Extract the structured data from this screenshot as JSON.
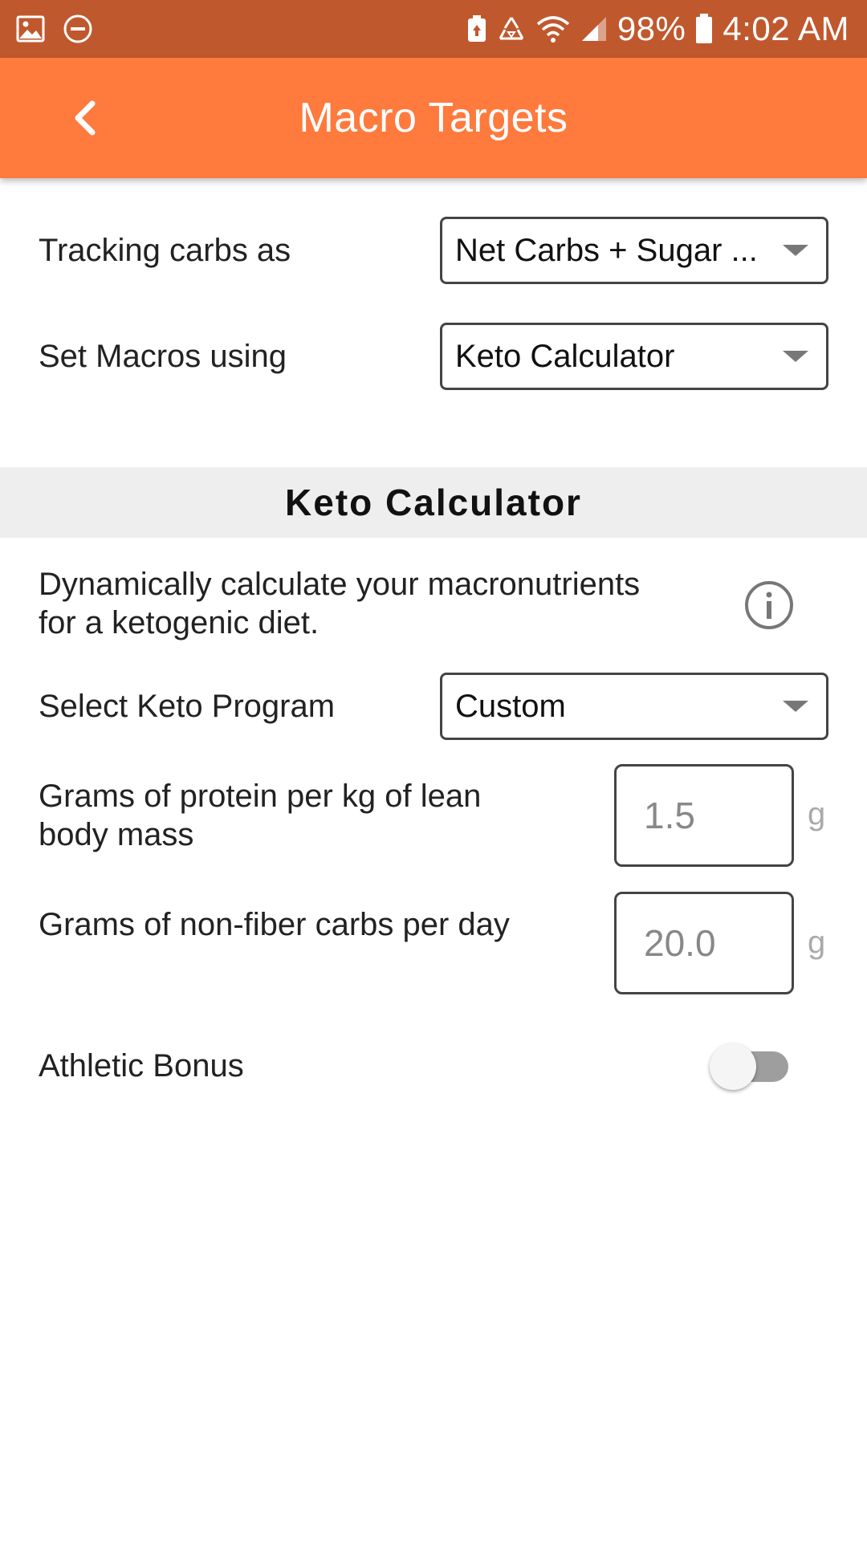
{
  "status_bar": {
    "left_icons": [
      "gallery-icon",
      "do-not-disturb-icon"
    ],
    "right_icons": [
      "battery-saver-icon",
      "recycle-icon",
      "wifi-icon",
      "signal-icon",
      "battery-icon"
    ],
    "battery": "98%",
    "time": "4:02 AM"
  },
  "app_bar": {
    "title": "Macro Targets",
    "back_icon": "chevron-left-icon",
    "color": "#ff7a3d"
  },
  "settings": {
    "tracking_label": "Tracking carbs as",
    "tracking_value": "Net Carbs + Sugar ...",
    "macros_label": "Set Macros using",
    "macros_value": "Keto Calculator"
  },
  "keto": {
    "header": "Keto Calculator",
    "description": "Dynamically calculate your macronutrients for a ketogenic diet.",
    "info_icon": "info-icon",
    "program_label": "Select Keto Program",
    "program_value": "Custom",
    "protein_label": "Grams of protein per kg of lean body mass",
    "protein_value": "1.5",
    "protein_unit": "g",
    "carbs_label": "Grams of non-fiber carbs per day",
    "carbs_value": "20.0",
    "carbs_unit": "g",
    "athletic_label": "Athletic Bonus",
    "athletic_on": false
  }
}
